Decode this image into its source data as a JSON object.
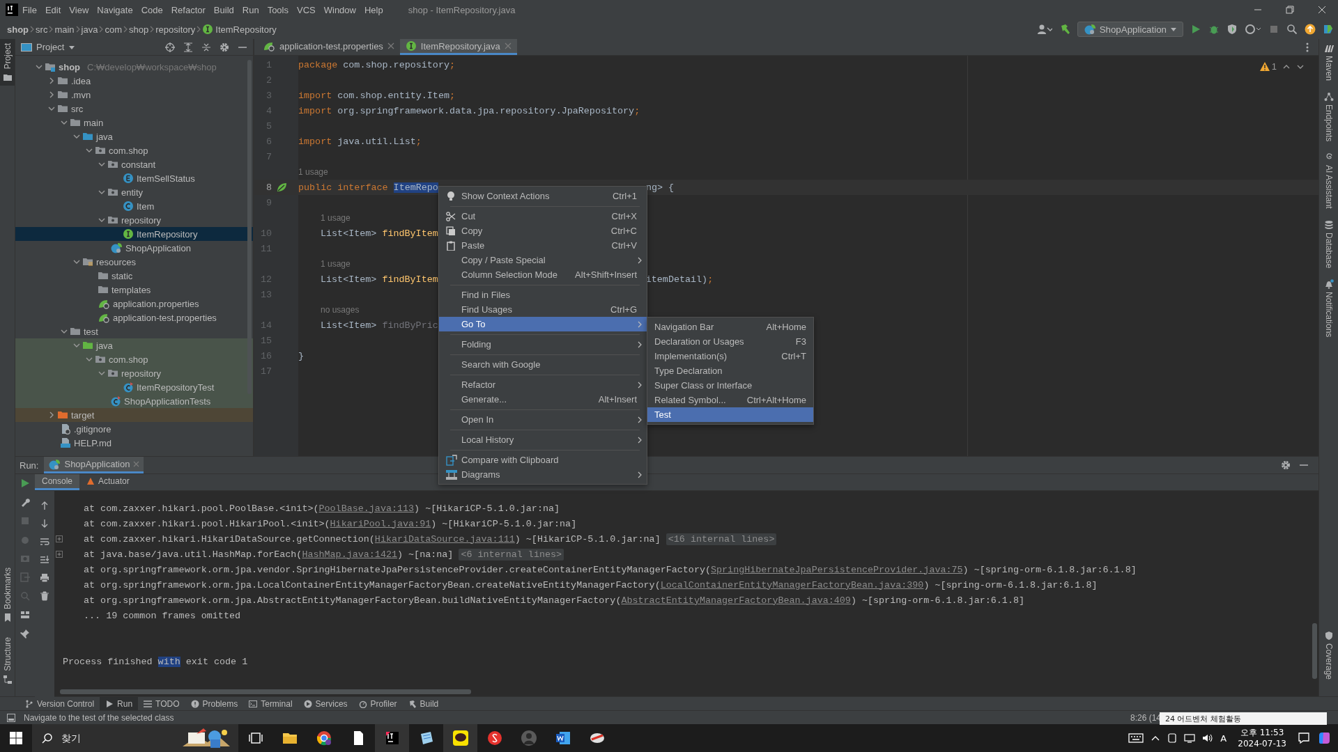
{
  "title_bar": {
    "menus": [
      "File",
      "Edit",
      "View",
      "Navigate",
      "Code",
      "Refactor",
      "Build",
      "Run",
      "Tools",
      "VCS",
      "Window",
      "Help"
    ],
    "title": "shop - ItemRepository.java"
  },
  "nav_bar": {
    "breadcrumbs": [
      "shop",
      "src",
      "main",
      "java",
      "com",
      "shop",
      "repository",
      "ItemRepository"
    ],
    "run_config": "ShopApplication"
  },
  "left_strip": {
    "top": [
      {
        "label": "Project",
        "selected": true
      }
    ],
    "bottom": [
      {
        "label": "Bookmarks",
        "selected": false
      },
      {
        "label": "Structure",
        "selected": false
      }
    ]
  },
  "right_strip": {
    "top": [
      {
        "label": "Maven"
      },
      {
        "label": "Endpoints"
      },
      {
        "label": "AI Assistant"
      },
      {
        "label": "Database"
      },
      {
        "label": "Notifications"
      }
    ],
    "bottom": [
      {
        "label": "Coverage"
      }
    ]
  },
  "project": {
    "title": "Project",
    "tree": [
      {
        "label": "shop",
        "kind": "module",
        "note": "C:₩develop₩workspace₩shop",
        "expanded": true,
        "selected": false,
        "children": [
          {
            "label": ".idea",
            "kind": "folder",
            "expanded": false,
            "selected": false
          },
          {
            "label": ".mvn",
            "kind": "folder",
            "expanded": false,
            "selected": false
          },
          {
            "label": "src",
            "kind": "folder",
            "expanded": true,
            "selected": false,
            "children": [
              {
                "label": "main",
                "kind": "folder",
                "expanded": true,
                "selected": false,
                "children": [
                  {
                    "label": "java",
                    "kind": "source-folder",
                    "expanded": true,
                    "selected": false,
                    "children": [
                      {
                        "label": "com.shop",
                        "kind": "package",
                        "expanded": true,
                        "selected": false,
                        "children": [
                          {
                            "label": "constant",
                            "kind": "package",
                            "expanded": true,
                            "selected": false,
                            "children": [
                              {
                                "label": "ItemSellStatus",
                                "kind": "enum",
                                "selected": false
                              }
                            ]
                          },
                          {
                            "label": "entity",
                            "kind": "package",
                            "expanded": true,
                            "selected": false,
                            "children": [
                              {
                                "label": "Item",
                                "kind": "class",
                                "selected": false
                              }
                            ]
                          },
                          {
                            "label": "repository",
                            "kind": "package",
                            "expanded": true,
                            "selected": false,
                            "children": [
                              {
                                "label": "ItemRepository",
                                "kind": "interface",
                                "selected": true
                              }
                            ]
                          },
                          {
                            "label": "ShopApplication",
                            "kind": "spring-class",
                            "selected": false
                          }
                        ]
                      }
                    ]
                  },
                  {
                    "label": "resources",
                    "kind": "resources-folder",
                    "expanded": true,
                    "selected": false,
                    "children": [
                      {
                        "label": "static",
                        "kind": "folder",
                        "selected": false
                      },
                      {
                        "label": "templates",
                        "kind": "folder",
                        "selected": false
                      },
                      {
                        "label": "application.properties",
                        "kind": "spring-props",
                        "selected": false
                      },
                      {
                        "label": "application-test.properties",
                        "kind": "spring-props",
                        "selected": false
                      }
                    ]
                  }
                ]
              },
              {
                "label": "test",
                "kind": "folder",
                "expanded": true,
                "selected": false,
                "children": [
                  {
                    "label": "java",
                    "kind": "test-folder",
                    "expanded": true,
                    "selected": false,
                    "children": [
                      {
                        "label": "com.shop",
                        "kind": "package",
                        "expanded": true,
                        "selected": false,
                        "children": [
                          {
                            "label": "repository",
                            "kind": "package",
                            "expanded": true,
                            "selected": false,
                            "children": [
                              {
                                "label": "ItemRepositoryTest",
                                "kind": "test-class",
                                "selected": false
                              }
                            ]
                          },
                          {
                            "label": "ShopApplicationTests",
                            "kind": "test-class",
                            "selected": false
                          }
                        ]
                      }
                    ]
                  }
                ]
              }
            ]
          },
          {
            "label": "target",
            "kind": "excluded-folder",
            "expanded": false,
            "selected": false
          },
          {
            "label": ".gitignore",
            "kind": "ignore-file",
            "selected": false
          },
          {
            "label": "HELP.md",
            "kind": "markdown",
            "selected": false
          }
        ]
      }
    ]
  },
  "editor": {
    "tabs": [
      {
        "label": "application-test.properties",
        "kind": "spring-props",
        "selected": false
      },
      {
        "label": "ItemRepository.java",
        "kind": "interface",
        "selected": true
      }
    ],
    "warnings": "1",
    "lines": [
      {
        "kind": "code",
        "number": "1",
        "current": false,
        "parts": [
          {
            "text": "package ",
            "kind": "keyword"
          },
          {
            "text": "com.shop.repository",
            "kind": "plain"
          },
          {
            "text": ";",
            "kind": "keyword"
          }
        ]
      },
      {
        "kind": "code",
        "number": "2",
        "current": false
      },
      {
        "kind": "code",
        "number": "3",
        "current": false,
        "parts": [
          {
            "text": "import ",
            "kind": "keyword"
          },
          {
            "text": "com.shop.entity.Item",
            "kind": "plain"
          },
          {
            "text": ";",
            "kind": "keyword"
          }
        ]
      },
      {
        "kind": "code",
        "number": "4",
        "current": false,
        "parts": [
          {
            "text": "import ",
            "kind": "keyword"
          },
          {
            "text": "org.springframework.data.jpa.repository.JpaRepository",
            "kind": "plain"
          },
          {
            "text": ";",
            "kind": "keyword"
          }
        ]
      },
      {
        "kind": "code",
        "number": "5",
        "current": false
      },
      {
        "kind": "code",
        "number": "6",
        "current": false,
        "parts": [
          {
            "text": "import ",
            "kind": "keyword"
          },
          {
            "text": "java.util.List",
            "kind": "plain"
          },
          {
            "text": ";",
            "kind": "keyword"
          }
        ]
      },
      {
        "kind": "code",
        "number": "7",
        "current": false
      },
      {
        "kind": "hint",
        "text": "1 usage",
        "indented": false
      },
      {
        "kind": "code",
        "number": "8",
        "current": true,
        "gutter_marker": true,
        "parts": [
          {
            "text": "public ",
            "kind": "keyword"
          },
          {
            "text": "interface ",
            "kind": "keyword"
          },
          {
            "text": "ItemRepo",
            "kind": "highlight"
          }
        ],
        "after": [
          {
            "text": "ng> {",
            "kind": "plain"
          }
        ]
      },
      {
        "kind": "code",
        "number": "9",
        "current": false
      },
      {
        "kind": "hint",
        "text": "1 usage",
        "indented": true
      },
      {
        "kind": "code",
        "number": "10",
        "current": false,
        "indented": true,
        "parts": [
          {
            "text": "List<Item> ",
            "kind": "plain"
          },
          {
            "text": "findByItem",
            "kind": "method"
          }
        ]
      },
      {
        "kind": "code",
        "number": "11",
        "current": false
      },
      {
        "kind": "hint",
        "text": "1 usage",
        "indented": true
      },
      {
        "kind": "code",
        "number": "12",
        "current": false,
        "indented": true,
        "parts": [
          {
            "text": "List<Item> ",
            "kind": "plain"
          },
          {
            "text": "findByItem",
            "kind": "method"
          }
        ],
        "after": [
          {
            "text": "itemDetail)",
            "kind": "plain"
          },
          {
            "text": ";",
            "kind": "keyword"
          }
        ]
      },
      {
        "kind": "code",
        "number": "13",
        "current": false
      },
      {
        "kind": "hint",
        "text": "no usages",
        "indented": true
      },
      {
        "kind": "code",
        "number": "14",
        "current": false,
        "indented": true,
        "parts": [
          {
            "text": "List<Item> ",
            "kind": "plain"
          },
          {
            "text": "findByPric",
            "kind": "unused"
          }
        ]
      },
      {
        "kind": "code",
        "number": "15",
        "current": false
      },
      {
        "kind": "code",
        "number": "16",
        "current": false,
        "parts": [
          {
            "text": "}",
            "kind": "plain"
          }
        ]
      },
      {
        "kind": "code",
        "number": "17",
        "current": false
      }
    ]
  },
  "context_menu": {
    "items": [
      {
        "kind": "item",
        "label": "Show Context Actions",
        "shortcut": "Ctrl+1",
        "submenu": false,
        "selected": false
      },
      {
        "kind": "separator"
      },
      {
        "kind": "item",
        "label": "Cut",
        "shortcut": "Ctrl+X",
        "submenu": false,
        "selected": false
      },
      {
        "kind": "item",
        "label": "Copy",
        "shortcut": "Ctrl+C",
        "submenu": false,
        "selected": false
      },
      {
        "kind": "item",
        "label": "Paste",
        "shortcut": "Ctrl+V",
        "submenu": false,
        "selected": false
      },
      {
        "kind": "item",
        "label": "Copy / Paste Special",
        "submenu": true,
        "selected": false
      },
      {
        "kind": "item",
        "label": "Column Selection Mode",
        "shortcut": "Alt+Shift+Insert",
        "submenu": false,
        "selected": false
      },
      {
        "kind": "separator"
      },
      {
        "kind": "item",
        "label": "Find in Files",
        "submenu": false,
        "selected": false
      },
      {
        "kind": "item",
        "label": "Find Usages",
        "shortcut": "Ctrl+G",
        "submenu": false,
        "selected": false
      },
      {
        "kind": "item",
        "label": "Go To",
        "submenu": true,
        "selected": true
      },
      {
        "kind": "separator"
      },
      {
        "kind": "item",
        "label": "Folding",
        "submenu": true,
        "selected": false
      },
      {
        "kind": "separator"
      },
      {
        "kind": "item",
        "label": "Search with Google",
        "submenu": false,
        "selected": false
      },
      {
        "kind": "separator"
      },
      {
        "kind": "item",
        "label": "Refactor",
        "submenu": true,
        "selected": false
      },
      {
        "kind": "item",
        "label": "Generate...",
        "shortcut": "Alt+Insert",
        "submenu": false,
        "selected": false
      },
      {
        "kind": "separator"
      },
      {
        "kind": "item",
        "label": "Open In",
        "submenu": true,
        "selected": false
      },
      {
        "kind": "separator"
      },
      {
        "kind": "item",
        "label": "Local History",
        "submenu": true,
        "selected": false
      },
      {
        "kind": "separator"
      },
      {
        "kind": "item",
        "label": "Compare with Clipboard",
        "submenu": false,
        "selected": false
      },
      {
        "kind": "item",
        "label": "Diagrams",
        "submenu": true,
        "selected": false
      }
    ]
  },
  "submenu": {
    "items": [
      {
        "label": "Navigation Bar",
        "shortcut": "Alt+Home",
        "selected": false
      },
      {
        "label": "Declaration or Usages",
        "shortcut": "F3",
        "selected": false
      },
      {
        "label": "Implementation(s)",
        "shortcut": "Ctrl+T",
        "selected": false
      },
      {
        "label": "Type Declaration",
        "selected": false
      },
      {
        "label": "Super Class or Interface",
        "selected": false
      },
      {
        "label": "Related Symbol...",
        "shortcut": "Ctrl+Alt+Home",
        "selected": false
      },
      {
        "label": "Test",
        "selected": true
      }
    ]
  },
  "run_panel": {
    "label": "Run:",
    "tabs": [
      {
        "label": "ShopApplication",
        "selected": true
      }
    ],
    "console_tabs": [
      {
        "label": "Console",
        "selected": true
      },
      {
        "label": "Actuator",
        "selected": false
      }
    ],
    "lines": [
      {
        "kind": "trace",
        "foldable": false,
        "parts": [
          {
            "text": "at com.zaxxer.hikari.pool.PoolBase.<init>(",
            "kind": "plain"
          },
          {
            "text": "PoolBase.java:113",
            "kind": "link"
          },
          {
            "text": ") ~[HikariCP-5.1.0.jar:na]",
            "kind": "plain"
          }
        ]
      },
      {
        "kind": "trace",
        "foldable": false,
        "parts": [
          {
            "text": "at com.zaxxer.hikari.pool.HikariPool.<init>(",
            "kind": "plain"
          },
          {
            "text": "HikariPool.java:91",
            "kind": "link"
          },
          {
            "text": ") ~[HikariCP-5.1.0.jar:na]",
            "kind": "plain"
          }
        ]
      },
      {
        "kind": "trace",
        "foldable": true,
        "parts": [
          {
            "text": "at com.zaxxer.hikari.HikariDataSource.getConnection(",
            "kind": "plain"
          },
          {
            "text": "HikariDataSource.java:111",
            "kind": "link"
          },
          {
            "text": ") ~[HikariCP-5.1.0.jar:na] ",
            "kind": "plain"
          },
          {
            "text": "<16 internal lines>",
            "kind": "fold"
          }
        ]
      },
      {
        "kind": "trace",
        "foldable": true,
        "parts": [
          {
            "text": "at java.base/java.util.HashMap.forEach(",
            "kind": "plain"
          },
          {
            "text": "HashMap.java:1421",
            "kind": "link"
          },
          {
            "text": ") ~[na:na] ",
            "kind": "plain"
          },
          {
            "text": "<6 internal lines>",
            "kind": "fold"
          }
        ]
      },
      {
        "kind": "trace",
        "foldable": false,
        "parts": [
          {
            "text": "at org.springframework.orm.jpa.vendor.SpringHibernateJpaPersistenceProvider.createContainerEntityManagerFactory(",
            "kind": "plain"
          },
          {
            "text": "SpringHibernateJpaPersistenceProvider.java:75",
            "kind": "link"
          },
          {
            "text": ") ~[spring-orm-6.1.8.jar:6.1.8]",
            "kind": "plain"
          }
        ]
      },
      {
        "kind": "trace",
        "foldable": false,
        "parts": [
          {
            "text": "at org.springframework.orm.jpa.LocalContainerEntityManagerFactoryBean.createNativeEntityManagerFactory(",
            "kind": "plain"
          },
          {
            "text": "LocalContainerEntityManagerFactoryBean.java:390",
            "kind": "link"
          },
          {
            "text": ") ~[spring-orm-6.1.8.jar:6.1.8]",
            "kind": "plain"
          }
        ]
      },
      {
        "kind": "trace",
        "foldable": false,
        "parts": [
          {
            "text": "at org.springframework.orm.jpa.AbstractEntityManagerFactoryBean.buildNativeEntityManagerFactory(",
            "kind": "plain"
          },
          {
            "text": "AbstractEntityManagerFactoryBean.java:409",
            "kind": "link"
          },
          {
            "text": ") ~[spring-orm-6.1.8.jar:6.1.8]",
            "kind": "plain"
          }
        ]
      },
      {
        "kind": "trace",
        "foldable": false,
        "parts": [
          {
            "text": "... 19 common frames omitted",
            "kind": "plain"
          }
        ]
      },
      {
        "kind": "exit",
        "foldable": false,
        "parts": [
          {
            "text": "Process finished ",
            "kind": "plain"
          },
          {
            "text": "with",
            "kind": "selection"
          },
          {
            "text": " exit code 1",
            "kind": "plain"
          }
        ]
      }
    ]
  },
  "tool_tabs": [
    {
      "label": "Version Control",
      "selected": false
    },
    {
      "label": "Run",
      "selected": true
    },
    {
      "label": "TODO",
      "selected": false
    },
    {
      "label": "Problems",
      "selected": false
    },
    {
      "label": "Terminal",
      "selected": false
    },
    {
      "label": "Services",
      "selected": false
    },
    {
      "label": "Profiler",
      "selected": false
    },
    {
      "label": "Build",
      "selected": false
    }
  ],
  "status_bar": {
    "message": "Navigate to the test of the selected class",
    "position": "8:26 (14",
    "popup": "24 어드벤처 체험활동"
  },
  "taskbar": {
    "search_placeholder": "찾기",
    "time": "오후 11:53",
    "date": "2024-07-13",
    "input_mode": "A"
  }
}
